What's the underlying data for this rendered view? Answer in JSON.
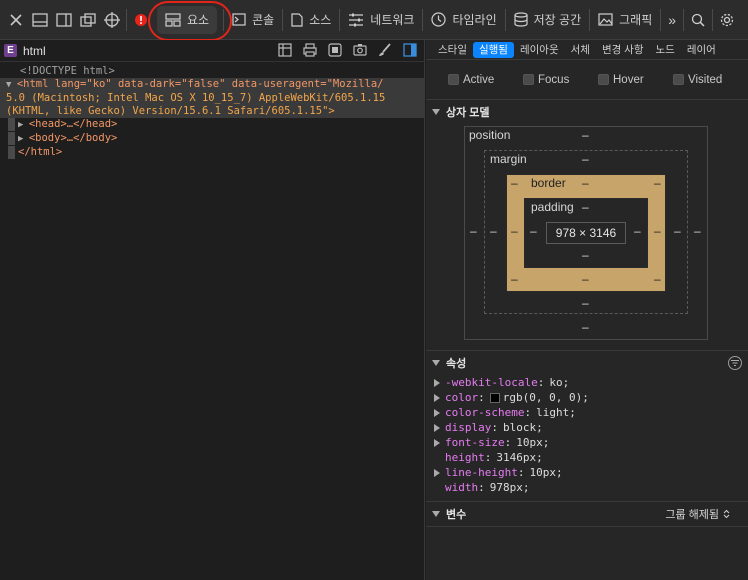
{
  "toolbar": {
    "tabs": [
      {
        "label": "요소",
        "icon": "elements-icon"
      },
      {
        "label": "콘솔",
        "icon": "console-icon"
      },
      {
        "label": "소스",
        "icon": "sources-icon"
      },
      {
        "label": "네트워크",
        "icon": "network-icon"
      },
      {
        "label": "타임라인",
        "icon": "timeline-icon"
      },
      {
        "label": "저장 공간",
        "icon": "storage-icon"
      },
      {
        "label": "그래픽",
        "icon": "graphics-icon"
      }
    ],
    "more": "»",
    "annotation_color": "#e5241a"
  },
  "left": {
    "title": "html",
    "badge": "E",
    "dom": {
      "doctype": "<!DOCTYPE html>",
      "html_open_1": "<html lang=\"ko\" data-dark=\"false\" data-useragent=\"Mozilla/",
      "html_open_2": "5.0 (Macintosh; Intel Mac OS X 10_15_7) AppleWebKit/605.1.15",
      "html_open_3": "(KHTML, like Gecko) Version/15.6.1 Safari/605.1.15\">",
      "head": "<head>…</head>",
      "body": "<body>…</body>",
      "html_close": "</html>"
    }
  },
  "right": {
    "tabs": [
      "스타일",
      "실행됨",
      "레이아웃",
      "서체",
      "변경 사항",
      "노드",
      "레이어"
    ],
    "active_tab": "실행됨",
    "states": [
      "Active",
      "Focus",
      "Hover",
      "Visited"
    ],
    "box_model": {
      "title": "상자 모델",
      "position_label": "position",
      "margin_label": "margin",
      "border_label": "border",
      "padding_label": "padding",
      "dash": "–",
      "content": "978 × 3146"
    },
    "properties": {
      "title": "속성",
      "items": [
        {
          "name": "-webkit-locale",
          "value": "ko",
          "expandable": true
        },
        {
          "name": "color",
          "value": "rgb(0, 0, 0)",
          "expandable": true,
          "swatch": "#000000"
        },
        {
          "name": "color-scheme",
          "value": "light",
          "expandable": true
        },
        {
          "name": "display",
          "value": "block",
          "expandable": true
        },
        {
          "name": "font-size",
          "value": "10px",
          "expandable": true
        },
        {
          "name": "height",
          "value": "3146px",
          "expandable": false
        },
        {
          "name": "line-height",
          "value": "10px",
          "expandable": true
        },
        {
          "name": "width",
          "value": "978px",
          "expandable": false
        }
      ]
    },
    "variables": {
      "title": "변수",
      "grouping": "그룹 해제됨"
    }
  }
}
